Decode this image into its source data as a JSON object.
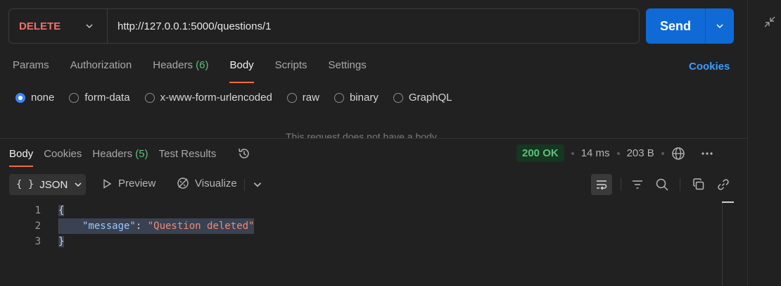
{
  "request": {
    "method": "DELETE",
    "url": "http://127.0.0.1:5000/questions/1",
    "send_label": "Send"
  },
  "request_tabs": [
    {
      "label": "Params"
    },
    {
      "label": "Authorization"
    },
    {
      "label": "Headers",
      "count": "(6)"
    },
    {
      "label": "Body",
      "active": true
    },
    {
      "label": "Scripts"
    },
    {
      "label": "Settings"
    }
  ],
  "cookies_label": "Cookies",
  "body_types": [
    {
      "label": "none",
      "checked": true
    },
    {
      "label": "form-data"
    },
    {
      "label": "x-www-form-urlencoded"
    },
    {
      "label": "raw"
    },
    {
      "label": "binary"
    },
    {
      "label": "GraphQL"
    }
  ],
  "no_body_text": "This request does not have a body",
  "response_tabs": [
    {
      "label": "Body",
      "active": true
    },
    {
      "label": "Cookies"
    },
    {
      "label": "Headers",
      "count": "(5)"
    },
    {
      "label": "Test Results"
    }
  ],
  "response_status": {
    "status": "200 OK",
    "time": "14 ms",
    "size": "203 B"
  },
  "response_toolbar": {
    "format": "JSON",
    "preview_label": "Preview",
    "visualize_label": "Visualize"
  },
  "response_body": {
    "line_numbers": [
      "1",
      "2",
      "3"
    ],
    "open_brace": "{",
    "key": "\"message\"",
    "colon": ": ",
    "value": "\"Question deleted\"",
    "close_brace": "}"
  },
  "icons": {
    "method_dropdown": "chevron-down-icon",
    "send_dropdown": "chevron-down-icon",
    "history": "history-icon",
    "globe": "globe-icon",
    "more": "more-horizontal-icon",
    "wrap": "wrap-lines-icon",
    "filter": "filter-icon",
    "search": "search-icon",
    "copy": "copy-icon",
    "link": "link-icon",
    "collapse": "collapse-icon"
  },
  "colors": {
    "method": "#f0706a",
    "send": "#0f6ad6",
    "accent_tab": "#f26b3a",
    "status_ok": "#5ec07d",
    "link": "#3c9bff"
  }
}
